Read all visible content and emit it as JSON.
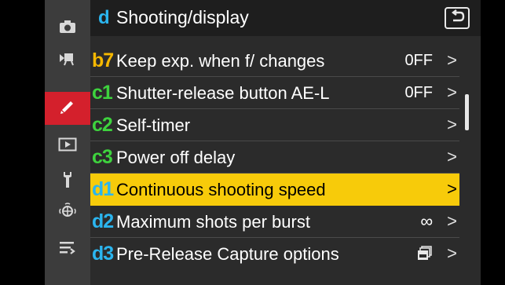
{
  "header": {
    "menu_letter": "d",
    "title": "Shooting/display",
    "back_icon": "return-arrow-icon"
  },
  "sidebar": {
    "items": [
      {
        "icon": "camera-icon",
        "active": false
      },
      {
        "icon": "movie-camera-icon",
        "active": false
      },
      {
        "icon": "pencil-icon",
        "active": true
      },
      {
        "icon": "playback-icon",
        "active": false
      },
      {
        "icon": "wrench-icon",
        "active": false
      },
      {
        "icon": "network-icon",
        "active": false
      },
      {
        "icon": "my-menu-icon",
        "active": false
      }
    ]
  },
  "menu": {
    "rows": [
      {
        "code": "b7",
        "label": "Keep exp. when f/ changes",
        "value": "0FF",
        "chevron": ">"
      },
      {
        "code": "c1",
        "label": "Shutter-release button AE-L",
        "value": "0FF",
        "chevron": ">"
      },
      {
        "code": "c2",
        "label": "Self-timer",
        "value": "",
        "chevron": ">"
      },
      {
        "code": "c3",
        "label": "Power off delay",
        "value": "",
        "chevron": ">"
      },
      {
        "code": "d1",
        "label": "Continuous shooting speed",
        "value": "",
        "chevron": ">"
      },
      {
        "code": "d2",
        "label": "Maximum shots per burst",
        "value": "∞",
        "chevron": ">"
      },
      {
        "code": "d3",
        "label": "Pre-Release Capture options",
        "value": "",
        "chevron": ">"
      }
    ]
  },
  "colors": {
    "b_group": "#f5b800",
    "c_group": "#3ed23e",
    "d_group": "#2bb5ef",
    "highlight": "#f7cb0a",
    "active_tab": "#d4202c"
  }
}
